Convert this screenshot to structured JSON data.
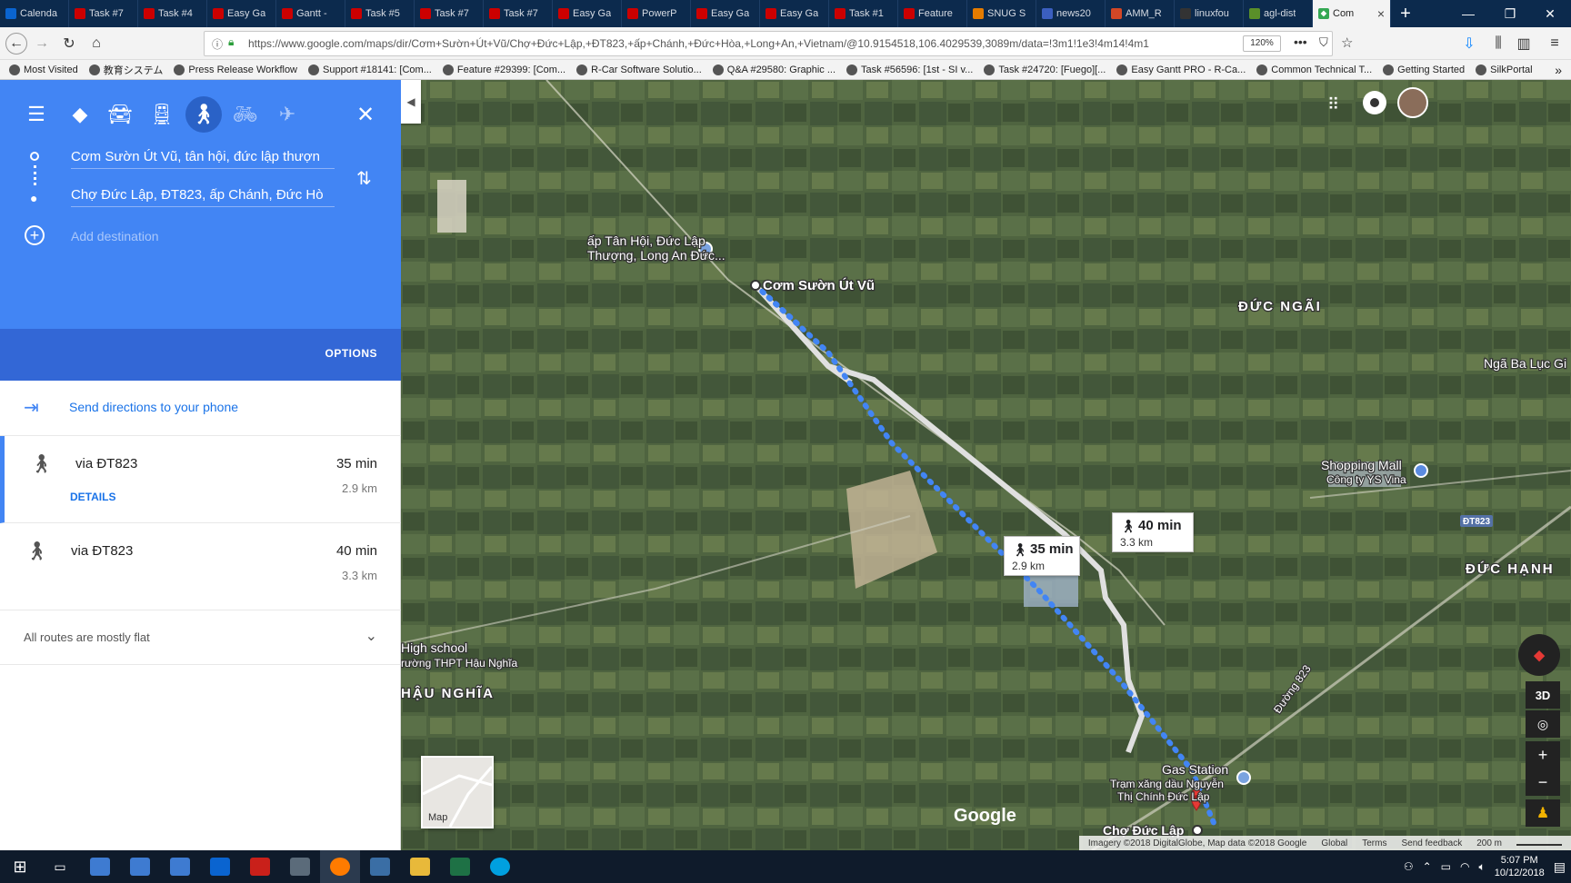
{
  "browser": {
    "tabs": [
      {
        "label": "Calenda",
        "color": "#0a64d0"
      },
      {
        "label": "Task #7",
        "color": "#c00"
      },
      {
        "label": "Task #4",
        "color": "#c00"
      },
      {
        "label": "Easy Ga",
        "color": "#c00"
      },
      {
        "label": "Gantt -",
        "color": "#c00"
      },
      {
        "label": "Task #5",
        "color": "#c00"
      },
      {
        "label": "Task #7",
        "color": "#c00"
      },
      {
        "label": "Task #7",
        "color": "#c00"
      },
      {
        "label": "Easy Ga",
        "color": "#c00"
      },
      {
        "label": "PowerP",
        "color": "#c00"
      },
      {
        "label": "Easy Ga",
        "color": "#c00"
      },
      {
        "label": "Easy Ga",
        "color": "#c00"
      },
      {
        "label": "Task #1",
        "color": "#c00"
      },
      {
        "label": "Feature",
        "color": "#c00"
      },
      {
        "label": "SNUG S",
        "color": "#e57c00"
      },
      {
        "label": "news20",
        "color": "#3b5fc0"
      },
      {
        "label": "AMM_R",
        "color": "#d24726"
      },
      {
        "label": "linuxfou",
        "color": "#333"
      },
      {
        "label": "agl-dist",
        "color": "#5a8f29"
      }
    ],
    "active_tab": "Com",
    "url": "https://www.google.com/maps/dir/Cơm+Sườn+Út+Vũ/Chợ+Đức+Lập,+ĐT823,+ấp+Chánh,+Đức+Hòa,+Long+An,+Vietnam/@10.9154518,106.4029539,3089m/data=!3m1!1e3!4m14!4m1",
    "zoom": "120%",
    "bookmarks": [
      "Most Visited",
      "教育システム",
      "Press Release Workflow",
      "Support #18141: [Com...",
      "Feature #29399: [Com...",
      "R-Car Software Solutio...",
      "Q&A #29580: Graphic ...",
      "Task #56596: [1st - SI v...",
      "Task #24720: [Fuego][...",
      "Easy Gantt PRO - R-Ca...",
      "Common Technical T...",
      "Getting Started",
      "SilkPortal"
    ]
  },
  "directions": {
    "origin": "Cơm Sườn Út Vũ, tân hội, đức lập thượn",
    "destination": "Chợ Đức Lập, ĐT823, ấp Chánh, Đức Hò",
    "add_destination": "Add destination",
    "options_label": "OPTIONS",
    "send_label": "Send directions to your phone",
    "routes": [
      {
        "via": "via ĐT823",
        "time": "35 min",
        "distance": "2.9 km",
        "details": "DETAILS"
      },
      {
        "via": "via ĐT823",
        "time": "40 min",
        "distance": "3.3 km"
      }
    ],
    "flat_note": "All routes are mostly flat"
  },
  "map": {
    "labels": {
      "tan_hoi_1": "ấp Tân Hội, Đức Lập",
      "tan_hoi_2": "Thượng, Long An Đức...",
      "origin": "Cơm Sườn Út Vũ",
      "duc_ngai": "ĐỨC NGÃI",
      "nga_ba": "Ngã Ba Lục Gi",
      "shopping": "Shopping Mall",
      "ys_vina": "Công ty YS Vina",
      "dt823": "ĐT823",
      "duc_hanh": "ĐỨC HẠNH",
      "high_school": "High school",
      "thpt": "rường THPT Hậu Nghĩa",
      "hau_nghia": "HẬU NGHĨA",
      "duong823": "Đường 823",
      "gas": "Gas Station",
      "tram1": "Trạm xăng dầu Nguyễn",
      "tram2": "Thị Chính Đức Lập",
      "cho": "Chợ Đức Lập",
      "google": "Google"
    },
    "callouts": [
      {
        "time": "35 min",
        "distance": "2.9 km"
      },
      {
        "time": "40 min",
        "distance": "3.3 km"
      }
    ],
    "minimap_label": "Map",
    "footer": {
      "imagery": "Imagery ©2018 DigitalGlobe, Map data ©2018 Google",
      "global": "Global",
      "terms": "Terms",
      "feedback": "Send feedback",
      "scale": "200 m"
    },
    "btn_3d": "3D"
  },
  "taskbar": {
    "time": "5:07 PM",
    "date": "10/12/2018"
  }
}
